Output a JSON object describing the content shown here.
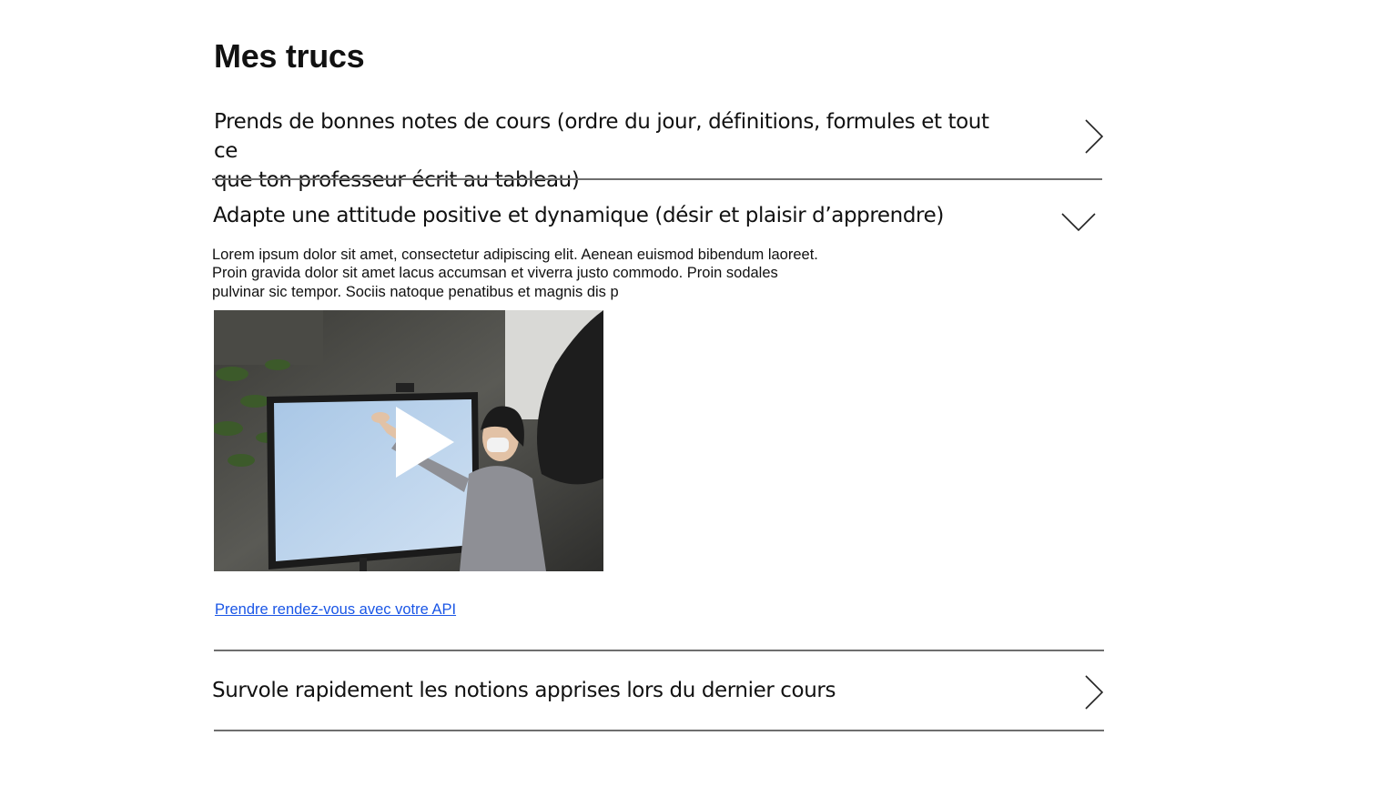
{
  "section": {
    "title": "Mes trucs"
  },
  "accordion": {
    "items": [
      {
        "label_line1": "Prends de bonnes notes de cours (ordre du jour, définitions, formules et tout ce",
        "label_line2": "que ton professeur écrit au tableau)",
        "state": "collapsed",
        "icon": "chevron-right-icon"
      },
      {
        "label": "Adapte une attitude positive et dynamique (désir et plaisir d’apprendre)",
        "state": "expanded",
        "icon": "chevron-down-icon",
        "body_lines": [
          "Lorem ipsum dolor sit amet, consectetur adipiscing elit. Aenean euismod bibendum laoreet.",
          "Proin gravida dolor sit amet lacus accumsan et viverra justo commodo. Proin sodales",
          "pulvinar sic tempor. Sociis natoque penatibus et magnis dis p"
        ],
        "video_icon": "play-icon",
        "link_text": "Prendre rendez-vous avec votre API"
      },
      {
        "label": "Survole rapidement les notions apprises lors du dernier cours",
        "state": "collapsed",
        "icon": "chevron-right-icon"
      }
    ]
  },
  "colors": {
    "text": "#111111",
    "divider": "#6e6e6e",
    "link": "#1a56e6",
    "background": "#ffffff"
  }
}
